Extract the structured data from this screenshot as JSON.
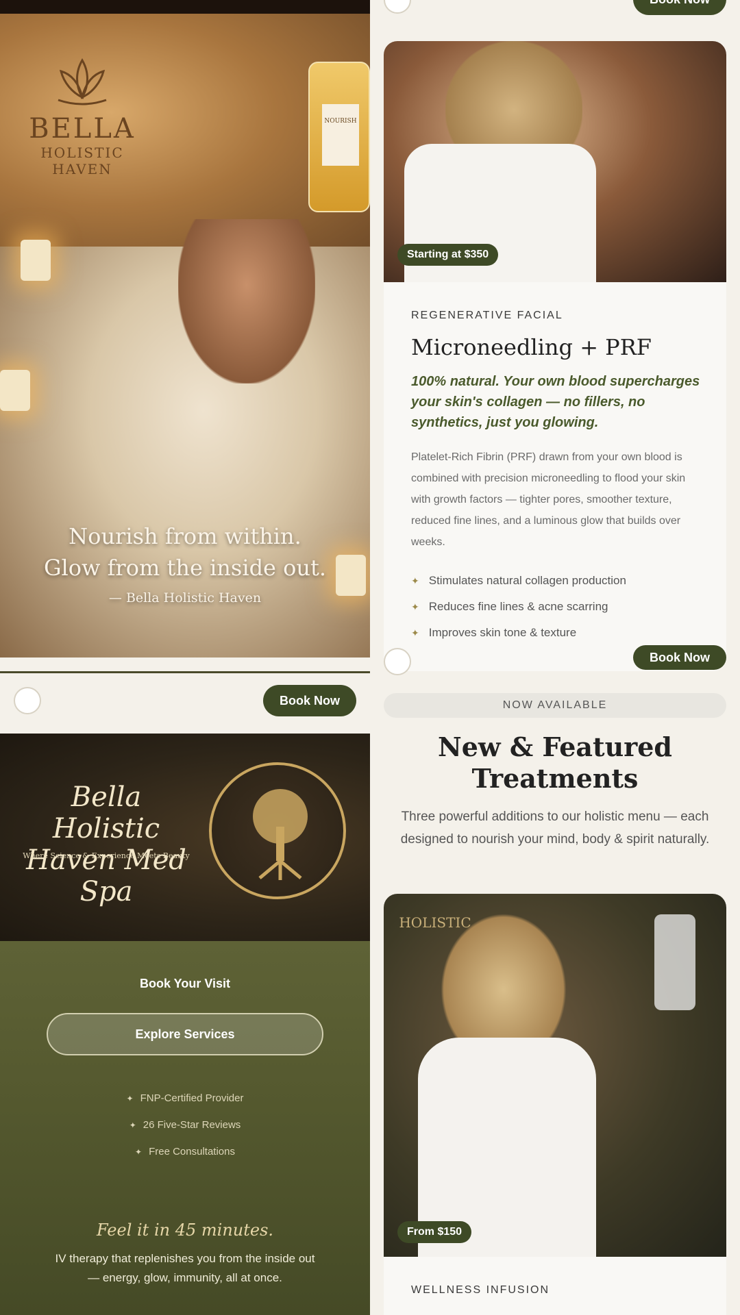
{
  "hero": {
    "logo_line1": "BELLA",
    "logo_line2": "HOLISTIC HAVEN",
    "iv_label": "NOURISH",
    "quote_line1": "Nourish from within.",
    "quote_line2": "Glow from the inside out.",
    "quote_signature": "— Bella Holistic Haven"
  },
  "card": {
    "book_now_label": "Book Now",
    "price_label": "Starting at $350",
    "eyebrow": "REGENERATIVE FACIAL",
    "title": "Microneedling + PRF",
    "tagline": "100% natural. Your own blood supercharges your skin's collagen — no fillers, no synthetics, just you glowing.",
    "description": "Platelet-Rich Fibrin (PRF) drawn from your own blood is combined with precision microneedling to flood your skin with growth factors — tighter pores, smoother texture, reduced fine lines, and a luminous glow that builds over weeks.",
    "bullets": [
      "Stimulates natural collagen production",
      "Reduces fine lines & acne scarring",
      "Improves skin tone & texture"
    ]
  },
  "visit": {
    "book_now_label": "Book Now",
    "banner_title": "Bella Holistic Haven Med Spa",
    "banner_subtitle": "Where Science & Experience Meets Beauty",
    "heading": "Book Your Visit",
    "explore_label": "Explore Services",
    "features": [
      "FNP-Certified Provider",
      "26 Five-Star Reviews",
      "Free Consultations"
    ],
    "feel_title": "Feel it in 45 minutes.",
    "feel_description": "IV therapy that replenishes you from the inside out — energy, glow, immunity, all at once."
  },
  "featured": {
    "pill": "NOW AVAILABLE",
    "title": "New & Featured Treatments",
    "description": "Three powerful additions to our holistic menu — each designed to nourish your mind, body & spirit naturally.",
    "photo_sign": "HOLISTIC",
    "price_label": "From $150",
    "eyebrow": "WELLNESS INFUSION"
  },
  "colors": {
    "olive": "#3e4a26",
    "cream": "#f4f1ea",
    "gold": "#c9a660"
  }
}
